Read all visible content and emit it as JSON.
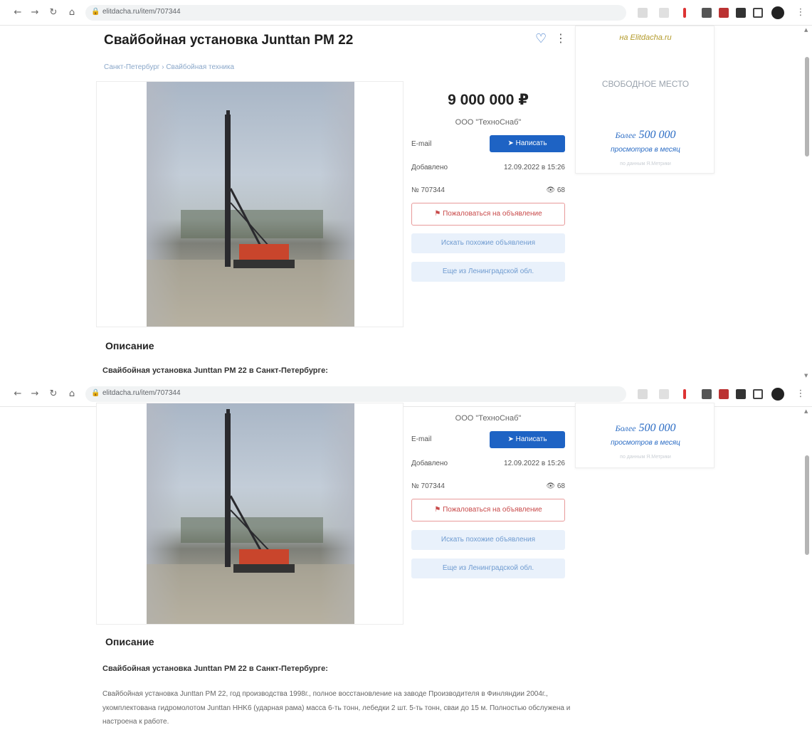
{
  "browser": {
    "url_top": "elitdacha.ru/item/707344",
    "url_bottom": "elitdacha.ru/item/707344",
    "back_icon": "arrow-left-icon",
    "forward_icon": "arrow-right-icon",
    "reload_icon": "reload-icon",
    "home_icon": "home-icon"
  },
  "listing": {
    "title": "Свайбойная установка Junttan PM 22",
    "breadcrumb": "Санкт-Петербург › Свайбойная техника",
    "price": "9 000 000 ₽",
    "seller": "ООО \"ТехноСнаб\"",
    "email_label": "E-mail",
    "write_button": "Написать",
    "added_label": "Добавлено",
    "added_value": "12.09.2022 в 15:26",
    "number_label": "№ 707344",
    "views": "68",
    "complain_button": "Пожаловаться на объявление",
    "similar_button": "Искать похожие объявления",
    "region_button": "Еще из Ленинградской обл."
  },
  "ad": {
    "site_text": "на Elitdacha.ru",
    "free_slot": "СВОБОДНОЕ МЕСТО",
    "views_prefix": "Более",
    "views_number": "500 000",
    "views_suffix": "просмотров в месяц",
    "footnote": "по данным Я.Метрики"
  },
  "description": {
    "heading": "Описание",
    "subheading": "Свайбойная установка Junttan PM 22 в Санкт-Петербурге:",
    "body": "Свайбойная установка Junttan PM 22, год производства 1998г., полное восстановление на заводе Производителя в Финляндии 2004г., укомплектована гидромолотом Junttan HHK6 (ударная рама) масса 6-ть тонн, лебедки 2 шт. 5-ть тонн, сваи до 15 м. Полностью обслужена и настроена к работе."
  },
  "colors": {
    "accent": "#1e63c4",
    "complain": "#c84a4a",
    "light_button": "#e9f1fb",
    "crane_red": "#c9452c"
  }
}
